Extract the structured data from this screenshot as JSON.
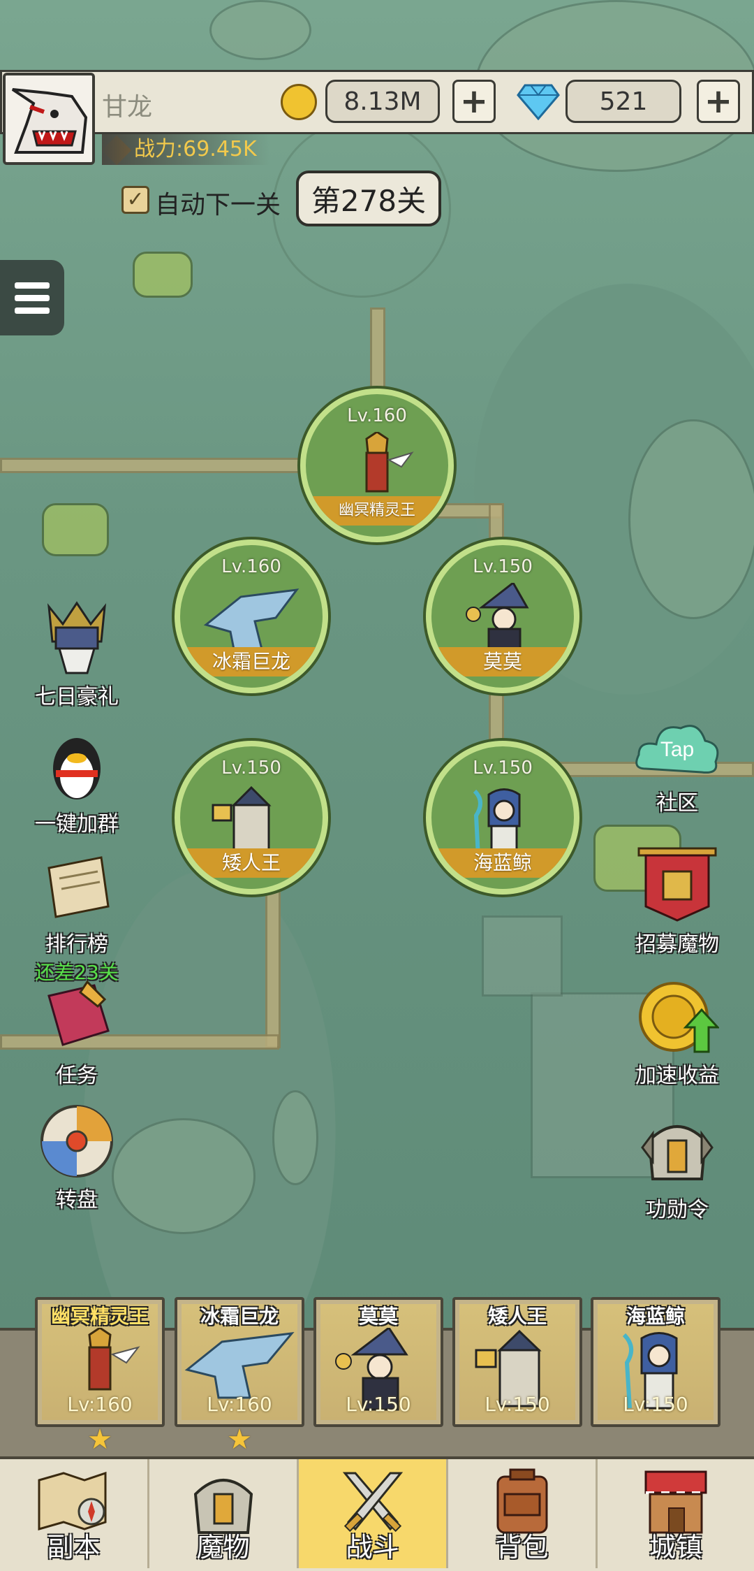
{
  "player": {
    "name": "甘龙",
    "power": "战力:69.45K"
  },
  "currency": {
    "gold": "8.13M",
    "gems": "521",
    "plus": "+"
  },
  "stage": {
    "auto_next_label": "自动下一关",
    "auto_next_checked": true,
    "check_mark": "✓",
    "current": "第278关"
  },
  "heroes_on_map": [
    {
      "name": "幽冥精灵王",
      "level": "Lv.160"
    },
    {
      "name": "冰霜巨龙",
      "level": "Lv.160"
    },
    {
      "name": "莫莫",
      "level": "Lv.150"
    },
    {
      "name": "矮人王",
      "level": "Lv.150"
    },
    {
      "name": "海蓝鲸",
      "level": "Lv.150"
    }
  ],
  "left_menu": {
    "seven_day": "七日豪礼",
    "join_group": "一键加群",
    "leaderboard": "排行榜",
    "leaderboard_sub": "还差23关",
    "tasks": "任务",
    "wheel": "转盘"
  },
  "right_menu": {
    "community": "社区",
    "community_badge": "Tap",
    "recruit": "招募魔物",
    "speedup": "加速收益",
    "merit": "功勋令"
  },
  "team": [
    {
      "name": "幽冥精灵王",
      "level": "Lv:160",
      "starred": true
    },
    {
      "name": "冰霜巨龙",
      "level": "Lv:160",
      "starred": true
    },
    {
      "name": "莫莫",
      "level": "Lv:150",
      "starred": false
    },
    {
      "name": "矮人王",
      "level": "Lv:150",
      "starred": false
    },
    {
      "name": "海蓝鲸",
      "level": "Lv:150",
      "starred": false
    }
  ],
  "star_glyph": "★",
  "nav": {
    "dungeon": "副本",
    "monsters": "魔物",
    "battle": "战斗",
    "bag": "背包",
    "town": "城镇",
    "active": "battle"
  },
  "colors": {
    "accent": "#f7d86b",
    "node_ring": "#c2e08a",
    "name_banner": "#d19a2a",
    "green_text": "#58e24a"
  }
}
